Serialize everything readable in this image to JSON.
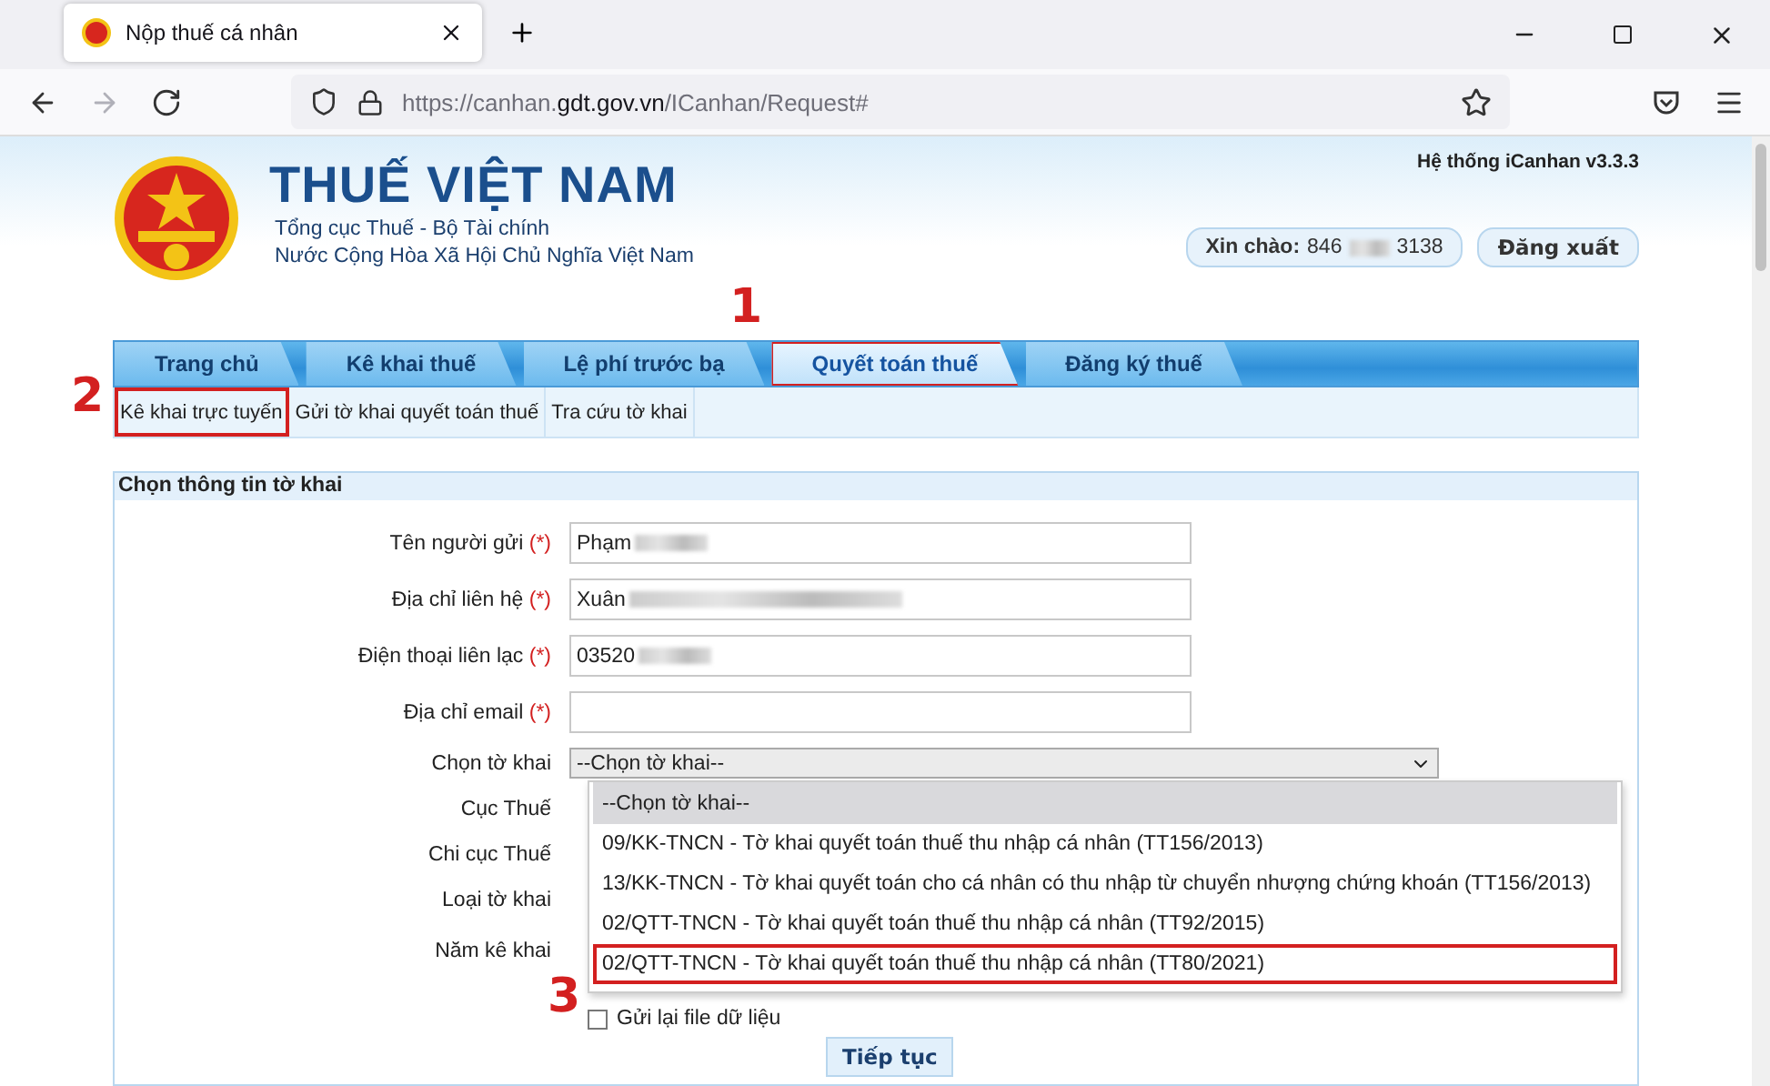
{
  "browser": {
    "tab_title": "Nộp thuế cá nhân",
    "url": {
      "prefix": "https://canhan.",
      "domain": "gdt.gov.vn",
      "path": "/ICanhan/Request#"
    },
    "nav_buttons": [
      {
        "kind": "back",
        "disabled": false
      },
      {
        "kind": "forward",
        "disabled": true
      },
      {
        "kind": "reload",
        "disabled": false
      }
    ]
  },
  "header": {
    "title": "THUẾ VIỆT NAM",
    "subtitle_lines": [
      "Tổng cục Thuế - Bộ Tài chính",
      "Nước Cộng Hòa Xã Hội Chủ Nghĩa Việt Nam"
    ],
    "version": "Hệ thống iCanhan v3.3.3",
    "greeting": {
      "label": "Xin chào:",
      "value_start": "846",
      "value_end": "3138"
    },
    "logout": "Đăng xuất"
  },
  "tabs": [
    {
      "label": "Trang chủ",
      "selected": false
    },
    {
      "label": "Kê khai thuế",
      "selected": false
    },
    {
      "label": "Lệ phí trước bạ",
      "selected": false
    },
    {
      "label": "Quyết toán thuế",
      "selected": true,
      "callout": "1"
    },
    {
      "label": "Đăng ký thuế",
      "selected": false
    }
  ],
  "submenu": [
    {
      "label": "Kê khai trực tuyến",
      "callout": "2"
    },
    {
      "label": "Gửi tờ khai quyết toán thuế"
    },
    {
      "label": "Tra cứu tờ khai"
    }
  ],
  "form": {
    "title": "Chọn thông tin tờ khai",
    "fields": [
      {
        "label": "Tên người gửi",
        "required": true,
        "value": "Phạm",
        "redacted": true
      },
      {
        "label": "Địa chỉ liên hệ",
        "required": true,
        "value": "Xuân",
        "redacted": true
      },
      {
        "label": "Điện thoại liên lạc",
        "required": true,
        "value": "03520",
        "redacted": true
      },
      {
        "label": "Địa chỉ email",
        "required": true
      }
    ],
    "required_mark": "(*)",
    "select": {
      "label": "Chọn tờ khai",
      "value": "--Chọn tờ khai--",
      "options": [
        {
          "label": "--Chọn tờ khai--",
          "selected": true
        },
        {
          "label": "09/KK-TNCN - Tờ khai quyết toán thuế thu nhập cá nhân (TT156/2013)",
          "selected": false
        },
        {
          "label": "13/KK-TNCN - Tờ khai quyết toán cho cá nhân có thu nhập từ chuyển nhượng chứng khoán (TT156/2013)",
          "selected": false
        },
        {
          "label": "02/QTT-TNCN - Tờ khai quyết toán thuế thu nhập cá nhân (TT92/2015)",
          "selected": false
        },
        {
          "label": "02/QTT-TNCN - Tờ khai quyết toán thuế thu nhập cá nhân (TT80/2021)",
          "selected": false,
          "callout": "3"
        }
      ]
    },
    "hidden_rows": [
      "Cục Thuế",
      "Chi cục Thuế",
      "Loại tờ khai",
      "Năm kê khai"
    ],
    "resend": {
      "label": "Gửi lại file dữ liệu",
      "checked": false
    },
    "submit": "Tiếp tục"
  }
}
